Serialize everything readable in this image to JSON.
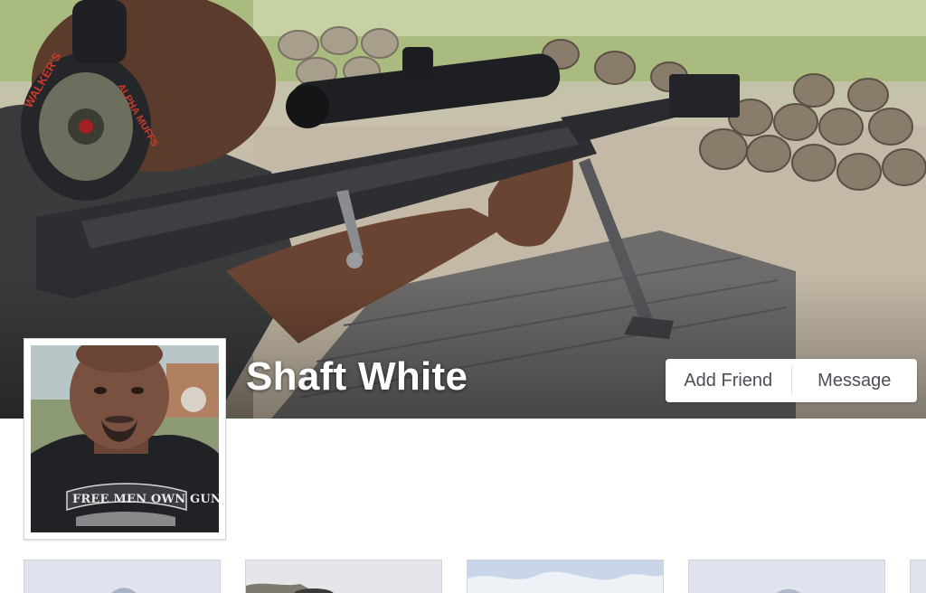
{
  "profile": {
    "name": "Shaft White"
  },
  "actions": {
    "add_friend_label": "Add Friend",
    "message_label": "Message"
  },
  "cover_photo": {
    "headphone_brand": "WALKER'S",
    "headphone_model": "ALPHA MUFFS"
  },
  "avatar": {
    "shirt_text": "FREE MEN OWN GUNS"
  },
  "thumbnails": [
    {
      "name": "thumb-1"
    },
    {
      "name": "thumb-2"
    },
    {
      "name": "thumb-3"
    },
    {
      "name": "thumb-4"
    },
    {
      "name": "thumb-5"
    }
  ],
  "colors": {
    "button_text": "#4b4f56",
    "page_bg": "#ffffff",
    "thumb_bg": "#dde3ef"
  }
}
